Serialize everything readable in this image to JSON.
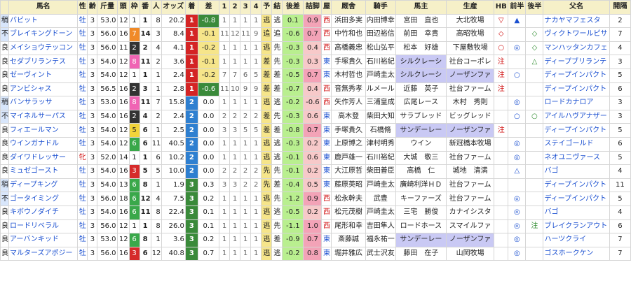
{
  "headers": [
    "馬名",
    "性",
    "齢",
    "斤量",
    "頭",
    "枠",
    "番",
    "人",
    "オッズ",
    "着",
    "差",
    "1",
    "2",
    "3",
    "4",
    "予",
    "結",
    "後差",
    "詰脚",
    "屋",
    "厩舎",
    "騎手",
    "馬主",
    "生産",
    "HB",
    "前半",
    "後半",
    "父名",
    "開隔"
  ],
  "rows": [
    {
      "cond": "稍",
      "name": "バビット",
      "sex": "牡",
      "age": "3",
      "kin": "53.0",
      "tou": "12",
      "waku": "1",
      "ban": "1",
      "nin": "8",
      "odds": "20.2",
      "chaku": "1",
      "sa": "-0.8",
      "p1": "1",
      "p2": "1",
      "p3": "1",
      "p4": "1",
      "yo": "逃",
      "kek": "逃",
      "kosa": "0.1",
      "tsume": "0.9",
      "ya": "西",
      "kyu": "浜田多実",
      "kishu": "内田博幸",
      "banu": "宮田　直也",
      "sei": "大北牧場",
      "hb": "▽",
      "zen": "▲",
      "kou": "",
      "chichi": "ナカヤマフェスタ",
      "kan": "2"
    },
    {
      "cond": "不",
      "name": "ブレイキングドーン",
      "sex": "牡",
      "age": "3",
      "kin": "56.0",
      "tou": "16",
      "waku": "7",
      "ban": "14",
      "nin": "3",
      "odds": "8.4",
      "chaku": "1",
      "sa": "-0.1",
      "p1": "11",
      "p2": "12",
      "p3": "11",
      "p4": "9",
      "yo": "追",
      "kek": "追",
      "kosa": "-0.6",
      "tsume": "0.7",
      "ya": "西",
      "kyu": "中竹和也",
      "kishu": "田辺裕信",
      "banu": "前田　幸貴",
      "sei": "高昭牧場",
      "hb": "◇",
      "zen": "",
      "kou": "◇",
      "chichi": "ヴィクトワールピサ",
      "kan": "7"
    },
    {
      "cond": "良",
      "name": "メイショウテッコン",
      "sex": "牡",
      "age": "3",
      "kin": "56.0",
      "tou": "11",
      "waku": "2",
      "ban": "2",
      "nin": "4",
      "odds": "4.1",
      "chaku": "1",
      "sa": "-0.2",
      "p1": "1",
      "p2": "1",
      "p3": "1",
      "p4": "1",
      "yo": "逃",
      "kek": "先",
      "kosa": "-0.3",
      "tsume": "0.4",
      "ya": "西",
      "kyu": "高橋義忠",
      "kishu": "松山弘平",
      "banu": "松本　好雄",
      "sei": "下屋敷牧場",
      "hb": "○",
      "zen": "◎",
      "kou": "◇",
      "chichi": "マンハッタンカフェ",
      "kan": "4"
    },
    {
      "cond": "良",
      "name": "セダブリランテス",
      "sex": "牡",
      "age": "3",
      "kin": "54.0",
      "tou": "12",
      "waku": "8",
      "ban": "11",
      "nin": "2",
      "odds": "3.6",
      "chaku": "1",
      "sa": "-0.1",
      "p1": "1",
      "p2": "1",
      "p3": "1",
      "p4": "1",
      "yo": "差",
      "kek": "先",
      "kosa": "-0.3",
      "tsume": "0.3",
      "ya": "東",
      "kyu": "手塚貴久",
      "kishu": "石川裕紀",
      "banu": "シルクレーシ",
      "sei": "社台コーポレ",
      "hb": "注",
      "zen": "",
      "kou": "△",
      "chichi": "ディープブリランテ",
      "kan": "3"
    },
    {
      "cond": "良",
      "name": "ゼーヴィント",
      "sex": "牡",
      "age": "3",
      "kin": "54.0",
      "tou": "12",
      "waku": "1",
      "ban": "1",
      "nin": "1",
      "odds": "2.4",
      "chaku": "1",
      "sa": "-0.2",
      "p1": "7",
      "p2": "7",
      "p3": "6",
      "p4": "5",
      "yo": "差",
      "kek": "差",
      "kosa": "-0.5",
      "tsume": "0.7",
      "ya": "東",
      "kyu": "木村哲也",
      "kishu": "戸崎圭太",
      "banu": "シルクレーシ",
      "sei": "ノーザンファ",
      "hb": "注",
      "zen": "○",
      "kou": "",
      "chichi": "ディープインパクト",
      "kan": "5"
    },
    {
      "cond": "良",
      "name": "アンビシャス",
      "sex": "牡",
      "age": "3",
      "kin": "56.5",
      "tou": "16",
      "waku": "2",
      "ban": "3",
      "nin": "1",
      "odds": "2.8",
      "chaku": "1",
      "sa": "-0.6",
      "p1": "11",
      "p2": "10",
      "p3": "9",
      "p4": "9",
      "yo": "差",
      "kek": "差",
      "kosa": "-0.7",
      "tsume": "0.4",
      "ya": "西",
      "kyu": "音無秀孝",
      "kishu": "ルメール",
      "banu": "近藤　英子",
      "sei": "社台ファーム",
      "hb": "注",
      "zen": "",
      "kou": "",
      "chichi": "ディープインパクト",
      "kan": "6"
    },
    {
      "cond": "稍",
      "name": "バンサラッサ",
      "sex": "牡",
      "age": "3",
      "kin": "53.0",
      "tou": "16",
      "waku": "8",
      "ban": "11",
      "nin": "7",
      "odds": "15.8",
      "chaku": "2",
      "sa": "0.0",
      "p1": "1",
      "p2": "1",
      "p3": "1",
      "p4": "1",
      "yo": "逃",
      "kek": "逃",
      "kosa": "-0.2",
      "tsume": "-0.6",
      "ya": "西",
      "kyu": "矢作芳人",
      "kishu": "三浦皇成",
      "banu": "広尾レース",
      "sei": "木村　秀則",
      "hb": "",
      "zen": "◎",
      "kou": "",
      "chichi": "ロードカナロア",
      "kan": "3"
    },
    {
      "cond": "不",
      "name": "マイネルサーパス",
      "sex": "牡",
      "age": "3",
      "kin": "54.0",
      "tou": "16",
      "waku": "2",
      "ban": "4",
      "nin": "2",
      "odds": "2.4",
      "chaku": "2",
      "sa": "0.0",
      "p1": "2",
      "p2": "2",
      "p3": "2",
      "p4": "2",
      "yo": "差",
      "kek": "先",
      "kosa": "-0.3",
      "tsume": "0.6",
      "ya": "東",
      "kyu": "高木登",
      "kishu": "柴田大知",
      "banu": "サラブレッド",
      "sei": "ビッグレッド",
      "hb": "",
      "zen": "○",
      "kou": "○",
      "chichi": "アイルハヴアナザー",
      "kan": "3"
    },
    {
      "cond": "良",
      "name": "フィエールマン",
      "sex": "牡",
      "age": "3",
      "kin": "54.0",
      "tou": "12",
      "waku": "5",
      "ban": "6",
      "nin": "1",
      "odds": "2.5",
      "chaku": "2",
      "sa": "0.0",
      "p1": "3",
      "p2": "3",
      "p3": "5",
      "p4": "5",
      "yo": "差",
      "kek": "差",
      "kosa": "-0.8",
      "tsume": "0.7",
      "ya": "東",
      "kyu": "手塚貴久",
      "kishu": "石橋脩",
      "banu": "サンデーレー",
      "sei": "ノーザンファ",
      "hb": "注",
      "zen": "",
      "kou": "",
      "chichi": "ディープインパクト",
      "kan": "5"
    },
    {
      "cond": "良",
      "name": "ウインガナドル",
      "sex": "牡",
      "age": "3",
      "kin": "54.0",
      "tou": "12",
      "waku": "6",
      "ban": "6",
      "nin": "11",
      "odds": "40.5",
      "chaku": "2",
      "sa": "0.0",
      "p1": "1",
      "p2": "1",
      "p3": "1",
      "p4": "1",
      "yo": "逃",
      "kek": "逃",
      "kosa": "-0.3",
      "tsume": "0.2",
      "ya": "東",
      "kyu": "上原博之",
      "kishu": "津村明秀",
      "banu": "ウイン",
      "sei": "新冠橋本牧場",
      "hb": "",
      "zen": "◎",
      "kou": "",
      "chichi": "ステイゴールド",
      "kan": "6"
    },
    {
      "cond": "良",
      "name": "ダイワドレッサー",
      "sex": "牝",
      "age": "3",
      "kin": "52.0",
      "tou": "14",
      "waku": "1",
      "ban": "1",
      "nin": "6",
      "odds": "10.2",
      "chaku": "2",
      "sa": "0.0",
      "p1": "1",
      "p2": "1",
      "p3": "1",
      "p4": "1",
      "yo": "逃",
      "kek": "逃",
      "kosa": "-0.1",
      "tsume": "0.6",
      "ya": "東",
      "kyu": "鹿戸雄一",
      "kishu": "石川裕紀",
      "banu": "大城　敬三",
      "sei": "社台ファーム",
      "hb": "",
      "zen": "◎",
      "kou": "",
      "chichi": "ネオユニヴァース",
      "kan": "5"
    },
    {
      "cond": "良",
      "name": "ミュゼゴースト",
      "sex": "牡",
      "age": "3",
      "kin": "54.0",
      "tou": "16",
      "waku": "3",
      "ban": "5",
      "nin": "5",
      "odds": "10.0",
      "chaku": "2",
      "sa": "0.0",
      "p1": "2",
      "p2": "2",
      "p3": "2",
      "p4": "2",
      "yo": "先",
      "kek": "先",
      "kosa": "-0.1",
      "tsume": "0.2",
      "ya": "東",
      "kyu": "大江原哲",
      "kishu": "柴田善臣",
      "banu": "高橋　仁",
      "sei": "城地　清満",
      "hb": "",
      "zen": "△",
      "kou": "",
      "chichi": "バゴ",
      "kan": "4"
    },
    {
      "cond": "稍",
      "name": "ディープキング",
      "sex": "牡",
      "age": "3",
      "kin": "54.0",
      "tou": "13",
      "waku": "6",
      "ban": "8",
      "nin": "1",
      "odds": "1.9",
      "chaku": "3",
      "sa": "0.3",
      "p1": "3",
      "p2": "3",
      "p3": "2",
      "p4": "2",
      "yo": "先",
      "kek": "差",
      "kosa": "-0.4",
      "tsume": "0.5",
      "ya": "東",
      "kyu": "藤原英昭",
      "kishu": "戸崎圭太",
      "banu": "廣崎利洋ＨＤ",
      "sei": "社台ファーム",
      "hb": "",
      "zen": "",
      "kou": "",
      "chichi": "ディープインパクト",
      "kan": "11"
    },
    {
      "cond": "不",
      "name": "ゴータイミング",
      "sex": "牡",
      "age": "3",
      "kin": "56.0",
      "tou": "18",
      "waku": "6",
      "ban": "12",
      "nin": "4",
      "odds": "7.5",
      "chaku": "3",
      "sa": "0.2",
      "p1": "1",
      "p2": "1",
      "p3": "1",
      "p4": "1",
      "yo": "逃",
      "kek": "先",
      "kosa": "-1.2",
      "tsume": "0.9",
      "ya": "西",
      "kyu": "松永幹夫",
      "kishu": "武豊",
      "banu": "キーファーズ",
      "sei": "社台ファーム",
      "hb": "",
      "zen": "◎",
      "kou": "",
      "chichi": "ディープインパクト",
      "kan": "5"
    },
    {
      "cond": "良",
      "name": "キボウノダイチ",
      "sex": "牡",
      "age": "3",
      "kin": "54.0",
      "tou": "16",
      "waku": "6",
      "ban": "11",
      "nin": "8",
      "odds": "22.4",
      "chaku": "3",
      "sa": "0.1",
      "p1": "1",
      "p2": "1",
      "p3": "1",
      "p4": "1",
      "yo": "逃",
      "kek": "逃",
      "kosa": "-0.5",
      "tsume": "0.2",
      "ya": "西",
      "kyu": "松元茂樹",
      "kishu": "戸崎圭太",
      "banu": "三宅　勝俊",
      "sei": "カナイシスタ",
      "hb": "",
      "zen": "◎",
      "kou": "",
      "chichi": "バゴ",
      "kan": "4"
    },
    {
      "cond": "良",
      "name": "ロードリベラル",
      "sex": "牡",
      "age": "3",
      "kin": "56.0",
      "tou": "12",
      "waku": "1",
      "ban": "1",
      "nin": "8",
      "odds": "26.0",
      "chaku": "3",
      "sa": "0.1",
      "p1": "1",
      "p2": "1",
      "p3": "1",
      "p4": "1",
      "yo": "逃",
      "kek": "先",
      "kosa": "-1.1",
      "tsume": "1.0",
      "ya": "西",
      "kyu": "尾形和幸",
      "kishu": "吉田隼人",
      "banu": "ロードホース",
      "sei": "スマイルファ",
      "hb": "",
      "zen": "◎",
      "kou": "注",
      "chichi": "ブレイクランアウト",
      "kan": "6"
    },
    {
      "cond": "良",
      "name": "アーバンキッド",
      "sex": "牡",
      "age": "3",
      "kin": "53.0",
      "tou": "12",
      "waku": "6",
      "ban": "8",
      "nin": "1",
      "odds": "3.6",
      "chaku": "3",
      "sa": "0.2",
      "p1": "1",
      "p2": "1",
      "p3": "1",
      "p4": "1",
      "yo": "逃",
      "kek": "差",
      "kosa": "-0.9",
      "tsume": "0.7",
      "ya": "東",
      "kyu": "斎藤誠",
      "kishu": "福永祐一",
      "banu": "サンデーレー",
      "sei": "ノーザンファ",
      "hb": "",
      "zen": "◎",
      "kou": "",
      "chichi": "ハーツクライ",
      "kan": "7"
    },
    {
      "cond": "良",
      "name": "マルターズアポジー",
      "sex": "牡",
      "age": "3",
      "kin": "56.0",
      "tou": "16",
      "waku": "3",
      "ban": "6",
      "nin": "12",
      "odds": "40.8",
      "chaku": "3",
      "sa": "0.7",
      "p1": "1",
      "p2": "1",
      "p3": "1",
      "p4": "1",
      "yo": "逃",
      "kek": "逃",
      "kosa": "-0.2",
      "tsume": "0.8",
      "ya": "東",
      "kyu": "堀井雅広",
      "kishu": "武士沢友",
      "banu": "藤田　在子",
      "sei": "山岡牧場",
      "hb": "",
      "zen": "◎",
      "kou": "",
      "chichi": "ゴスホークケン",
      "kan": "7"
    }
  ]
}
